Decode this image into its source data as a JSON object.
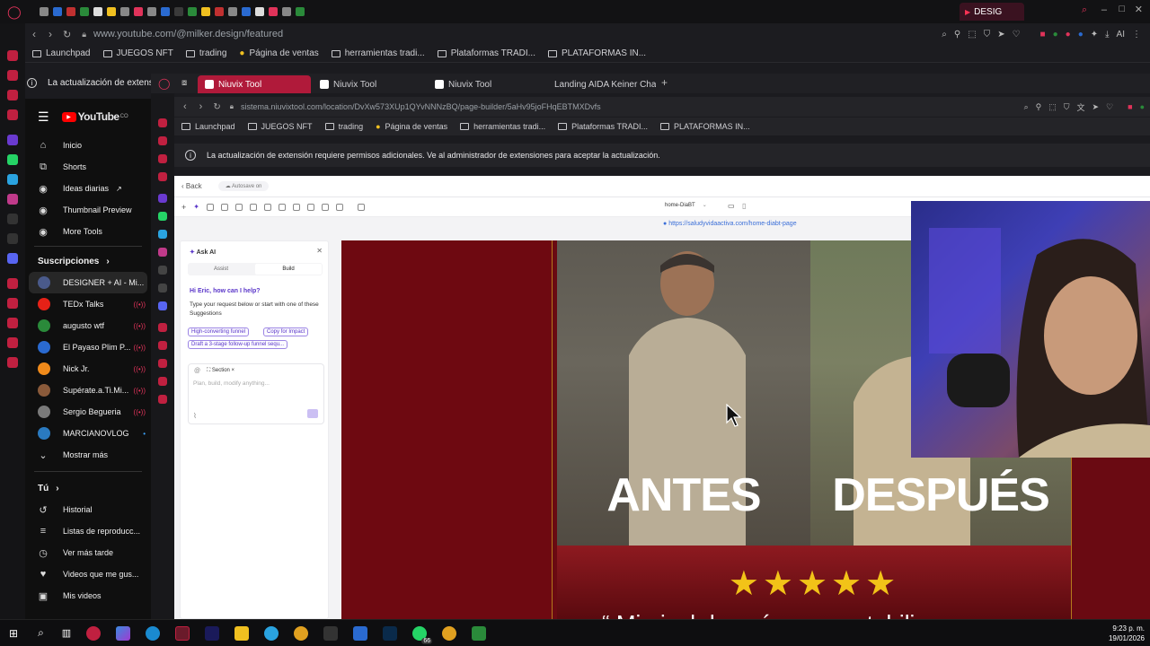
{
  "outer_browser": {
    "active_tab": "DESIG",
    "url": "www.youtube.com/@milker.design/featured",
    "bookmarks": [
      "Launchpad",
      "JUEGOS NFT",
      "trading",
      "Página de ventas",
      "herramientas tradi...",
      "Plataformas TRADI...",
      "PLATAFORMAS IN..."
    ],
    "notice": "La actualización de extens"
  },
  "youtube": {
    "logo": "YouTube",
    "country": "CO",
    "nav": [
      {
        "label": "Inicio",
        "icon": "home-icon"
      },
      {
        "label": "Shorts",
        "icon": "shorts-icon"
      },
      {
        "label": "Ideas diarias",
        "icon": "channel-icon"
      },
      {
        "label": "Thumbnail Preview",
        "icon": "channel-icon"
      },
      {
        "label": "More Tools",
        "icon": "channel-icon"
      }
    ],
    "subs_title": "Suscripciones",
    "subscriptions": [
      {
        "name": "DESIGNER + AI - Mi...",
        "color": "#4a5a8a",
        "live": false
      },
      {
        "name": "TEDx Talks",
        "color": "#e62117",
        "live": true
      },
      {
        "name": "augusto wtf",
        "color": "#2a8a3a",
        "live": true
      },
      {
        "name": "El Payaso Plim P...",
        "color": "#2a6ad0",
        "live": true
      },
      {
        "name": "Nick Jr.",
        "color": "#f08a1a",
        "live": true
      },
      {
        "name": "Supérate.a.Ti.Mi...",
        "color": "#8a5a3a",
        "live": true
      },
      {
        "name": "Sergio Begueria",
        "color": "#7a7a7a",
        "live": true
      },
      {
        "name": "MARCIANOVLOG",
        "color": "#2a7ac0",
        "live": true
      }
    ],
    "show_more": "Mostrar más",
    "you_title": "Tú",
    "you_items": [
      {
        "label": "Historial",
        "icon": "history-icon"
      },
      {
        "label": "Listas de reproducc...",
        "icon": "playlist-icon"
      },
      {
        "label": "Ver más tarde",
        "icon": "clock-icon"
      },
      {
        "label": "Videos que me gus...",
        "icon": "like-icon"
      },
      {
        "label": "Mis videos",
        "icon": "video-icon"
      }
    ]
  },
  "inner_browser": {
    "tabs": [
      "Niuvix Tool",
      "Niuvix Tool",
      "Niuvix Tool",
      "Landing AIDA Keiner Char"
    ],
    "url": "sistema.niuvixtool.com/location/DvXw573XUp1QYvNNNzBQ/page-builder/5aHv95joFHqEBTMXDvfs",
    "bookmarks": [
      "Launchpad",
      "JUEGOS NFT",
      "trading",
      "Página de ventas",
      "herramientas tradi...",
      "Plataformas TRADI...",
      "PLATAFORMAS IN..."
    ],
    "notice": "La actualización de extensión requiere permisos adicionales. Ve al administrador de extensiones para aceptar la actualización."
  },
  "builder": {
    "back": "Back",
    "autosave": "Autosave on",
    "page_select": "home-DiaBT",
    "page_url": "https://saludyvidaactiva.com/home-diabt-page",
    "ai": {
      "title": "Ask AI",
      "tab_assist": "Assist",
      "tab_build": "Build",
      "greeting": "Hi Eric, how can I help?",
      "hint": "Type your request below or start with one of these Suggestions",
      "chips": [
        "High-converting funnel",
        "Copy for Impact",
        "Draft a 3-stage follow-up funnel sequ..."
      ],
      "section_tag": "Section",
      "placeholder": "Plan, build, modify anything..."
    },
    "hero": {
      "before": "ANTES",
      "after": "DESPUÉS",
      "stars": "★★★★★",
      "quote": "“ Mi nivel  de  azúcar  se  estabili"
    }
  },
  "taskbar": {
    "time": "9:23 p. m.",
    "date": "19/01/2026",
    "badge": "66"
  },
  "colors": {
    "hero_red": "#6a0a12",
    "accent_purple": "#5a36c9",
    "star_gold": "#f2c318",
    "yt_red": "#ff0000"
  }
}
